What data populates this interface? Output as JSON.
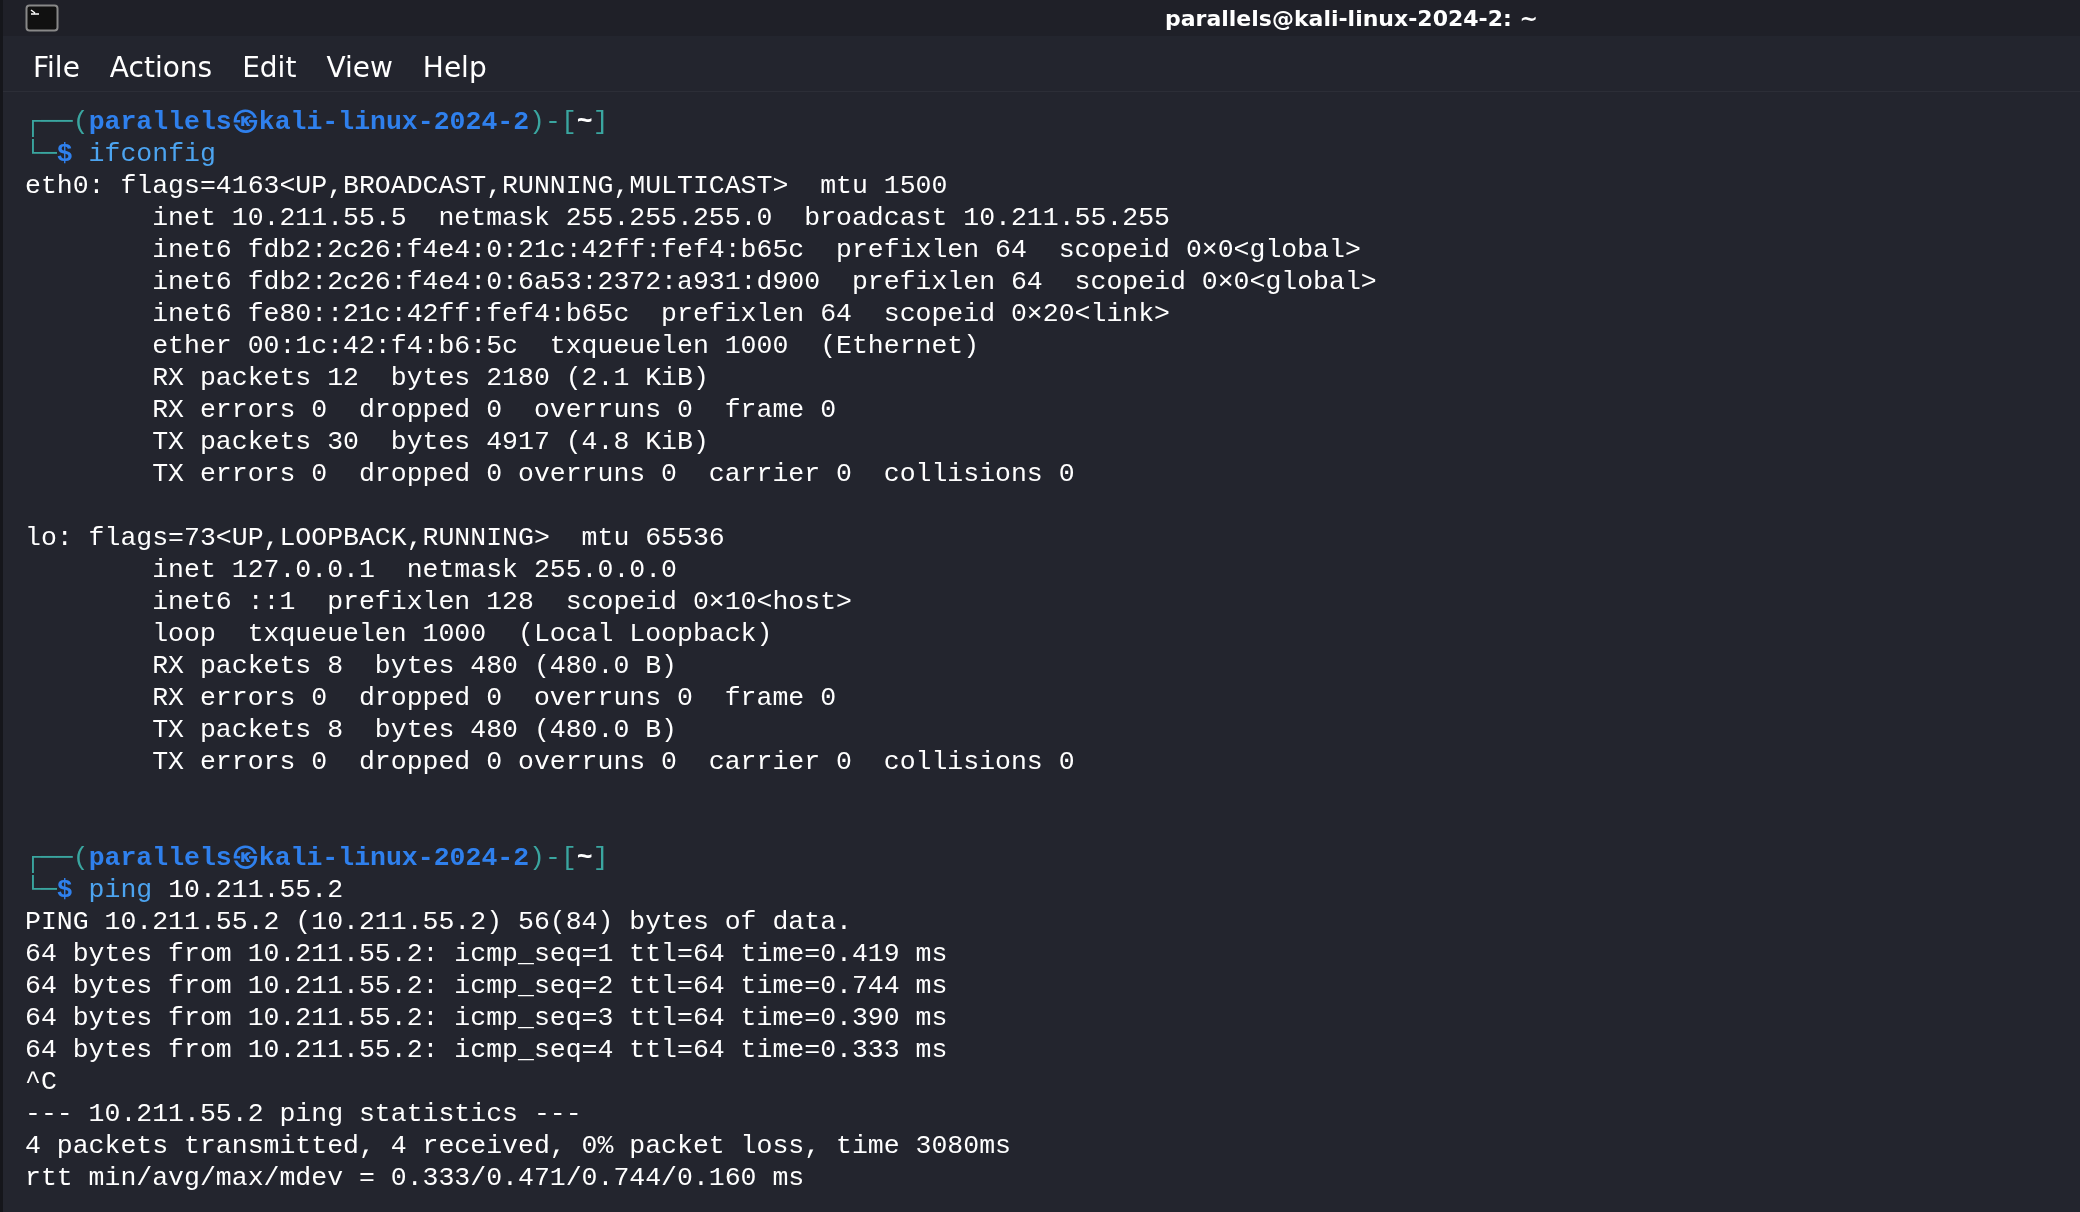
{
  "window": {
    "title": "parallels@kali-linux-2024-2: ~"
  },
  "menu": [
    "File",
    "Actions",
    "Edit",
    "View",
    "Help"
  ],
  "lines": [
    {
      "kind": "prompt",
      "segments": [
        {
          "kind": "frame",
          "text": "┌──("
        },
        {
          "kind": "user",
          "text": "parallels㉿kali-linux-2024-2"
        },
        {
          "kind": "frame",
          "text": ")-["
        },
        {
          "kind": "dir",
          "text": "~"
        },
        {
          "kind": "frame",
          "text": "]"
        }
      ]
    },
    {
      "kind": "prompt",
      "segments": [
        {
          "kind": "frame",
          "text": "└─"
        },
        {
          "kind": "user",
          "text": "$"
        },
        {
          "kind": "command",
          "text": " ifconfig"
        }
      ]
    },
    {
      "kind": "output",
      "text": "eth0: flags=4163<UP,BROADCAST,RUNNING,MULTICAST>  mtu 1500"
    },
    {
      "kind": "output",
      "text": "        inet 10.211.55.5  netmask 255.255.255.0  broadcast 10.211.55.255"
    },
    {
      "kind": "output",
      "text": "        inet6 fdb2:2c26:f4e4:0:21c:42ff:fef4:b65c  prefixlen 64  scopeid 0×0<global>"
    },
    {
      "kind": "output",
      "text": "        inet6 fdb2:2c26:f4e4:0:6a53:2372:a931:d900  prefixlen 64  scopeid 0×0<global>"
    },
    {
      "kind": "output",
      "text": "        inet6 fe80::21c:42ff:fef4:b65c  prefixlen 64  scopeid 0×20<link>"
    },
    {
      "kind": "output",
      "text": "        ether 00:1c:42:f4:b6:5c  txqueuelen 1000  (Ethernet)"
    },
    {
      "kind": "output",
      "text": "        RX packets 12  bytes 2180 (2.1 KiB)"
    },
    {
      "kind": "output",
      "text": "        RX errors 0  dropped 0  overruns 0  frame 0"
    },
    {
      "kind": "output",
      "text": "        TX packets 30  bytes 4917 (4.8 KiB)"
    },
    {
      "kind": "output",
      "text": "        TX errors 0  dropped 0 overruns 0  carrier 0  collisions 0"
    },
    {
      "kind": "blank"
    },
    {
      "kind": "output",
      "text": "lo: flags=73<UP,LOOPBACK,RUNNING>  mtu 65536"
    },
    {
      "kind": "output",
      "text": "        inet 127.0.0.1  netmask 255.0.0.0"
    },
    {
      "kind": "output",
      "text": "        inet6 ::1  prefixlen 128  scopeid 0×10<host>"
    },
    {
      "kind": "output",
      "text": "        loop  txqueuelen 1000  (Local Loopback)"
    },
    {
      "kind": "output",
      "text": "        RX packets 8  bytes 480 (480.0 B)"
    },
    {
      "kind": "output",
      "text": "        RX errors 0  dropped 0  overruns 0  frame 0"
    },
    {
      "kind": "output",
      "text": "        TX packets 8  bytes 480 (480.0 B)"
    },
    {
      "kind": "output",
      "text": "        TX errors 0  dropped 0 overruns 0  carrier 0  collisions 0"
    },
    {
      "kind": "blank"
    },
    {
      "kind": "blank"
    },
    {
      "kind": "prompt",
      "segments": [
        {
          "kind": "frame",
          "text": "┌──("
        },
        {
          "kind": "user",
          "text": "parallels㉿kali-linux-2024-2"
        },
        {
          "kind": "frame",
          "text": ")-["
        },
        {
          "kind": "dir",
          "text": "~"
        },
        {
          "kind": "frame",
          "text": "]"
        }
      ]
    },
    {
      "kind": "prompt",
      "segments": [
        {
          "kind": "frame",
          "text": "└─"
        },
        {
          "kind": "user",
          "text": "$"
        },
        {
          "kind": "command",
          "text": " ping"
        },
        {
          "kind": "plain",
          "text": " 10.211.55.2"
        }
      ]
    },
    {
      "kind": "output",
      "text": "PING 10.211.55.2 (10.211.55.2) 56(84) bytes of data."
    },
    {
      "kind": "output",
      "text": "64 bytes from 10.211.55.2: icmp_seq=1 ttl=64 time=0.419 ms"
    },
    {
      "kind": "output",
      "text": "64 bytes from 10.211.55.2: icmp_seq=2 ttl=64 time=0.744 ms"
    },
    {
      "kind": "output",
      "text": "64 bytes from 10.211.55.2: icmp_seq=3 ttl=64 time=0.390 ms"
    },
    {
      "kind": "output",
      "text": "64 bytes from 10.211.55.2: icmp_seq=4 ttl=64 time=0.333 ms"
    },
    {
      "kind": "output",
      "text": "^C"
    },
    {
      "kind": "output",
      "text": "--- 10.211.55.2 ping statistics ---"
    },
    {
      "kind": "output",
      "text": "4 packets transmitted, 4 received, 0% packet loss, time 3080ms"
    },
    {
      "kind": "output",
      "text": "rtt min/avg/max/mdev = 0.333/0.471/0.744/0.160 ms"
    }
  ]
}
